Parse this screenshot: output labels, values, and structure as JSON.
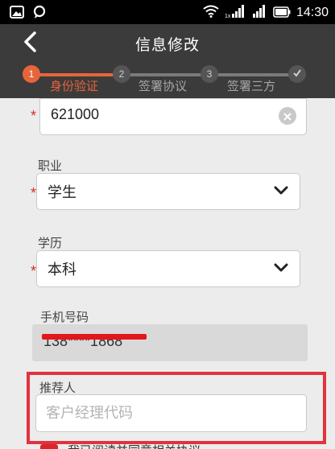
{
  "status_bar": {
    "time": "14:30",
    "icons": [
      "image-icon",
      "chat-bubble-icon",
      "wifi-icon",
      "signal-icon",
      "signal-icon",
      "battery-icon"
    ]
  },
  "header": {
    "title": "信息修改",
    "back_icon": "chevron-left-icon"
  },
  "steps": [
    {
      "number": "1",
      "label": "身份验证",
      "state": "active"
    },
    {
      "number": "2",
      "label": "签署协议",
      "state": "inactive"
    },
    {
      "number": "3",
      "label": "签署三方",
      "state": "inactive"
    },
    {
      "number": "",
      "label": "",
      "state": "inactive",
      "icon": "check-icon"
    }
  ],
  "form": {
    "postal_code": {
      "value": "621000",
      "required": true
    },
    "occupation": {
      "label": "职业",
      "value": "学生",
      "required": true
    },
    "education": {
      "label": "学历",
      "value": "本科",
      "required": true
    },
    "phone": {
      "label": "手机号码",
      "value": "138****1868",
      "redacted": true
    },
    "referrer": {
      "label": "推荐人",
      "placeholder": "客户经理代码",
      "value": ""
    },
    "agreement_text": "我已阅读并同意相关协议"
  },
  "colors": {
    "accent": "#e8643a",
    "header_bg": "#3b3b3b",
    "required_star": "#d2311f",
    "highlight_border": "#e0333d"
  }
}
